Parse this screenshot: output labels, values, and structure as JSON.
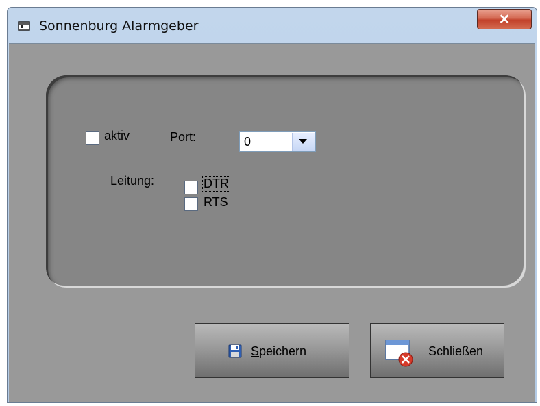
{
  "window": {
    "title": "Sonnenburg Alarmgeber",
    "close_symbol": "✕"
  },
  "form": {
    "aktiv_label": "aktiv",
    "aktiv_checked": false,
    "port_label": "Port:",
    "port_value": "0",
    "leitung_label": "Leitung:",
    "dtr_label": "DTR",
    "dtr_checked": false,
    "rts_label": "RTS",
    "rts_checked": false
  },
  "buttons": {
    "save_label_mnemonic": "S",
    "save_label_rest": "peichern",
    "close_label": "Schließen"
  },
  "icons": {
    "app": "window-icon",
    "save": "floppy-disk-icon",
    "close_window": "window-close-icon"
  },
  "colors": {
    "client_bg": "#999999",
    "panel_bg": "#868686",
    "close_button": "#c2412a"
  }
}
